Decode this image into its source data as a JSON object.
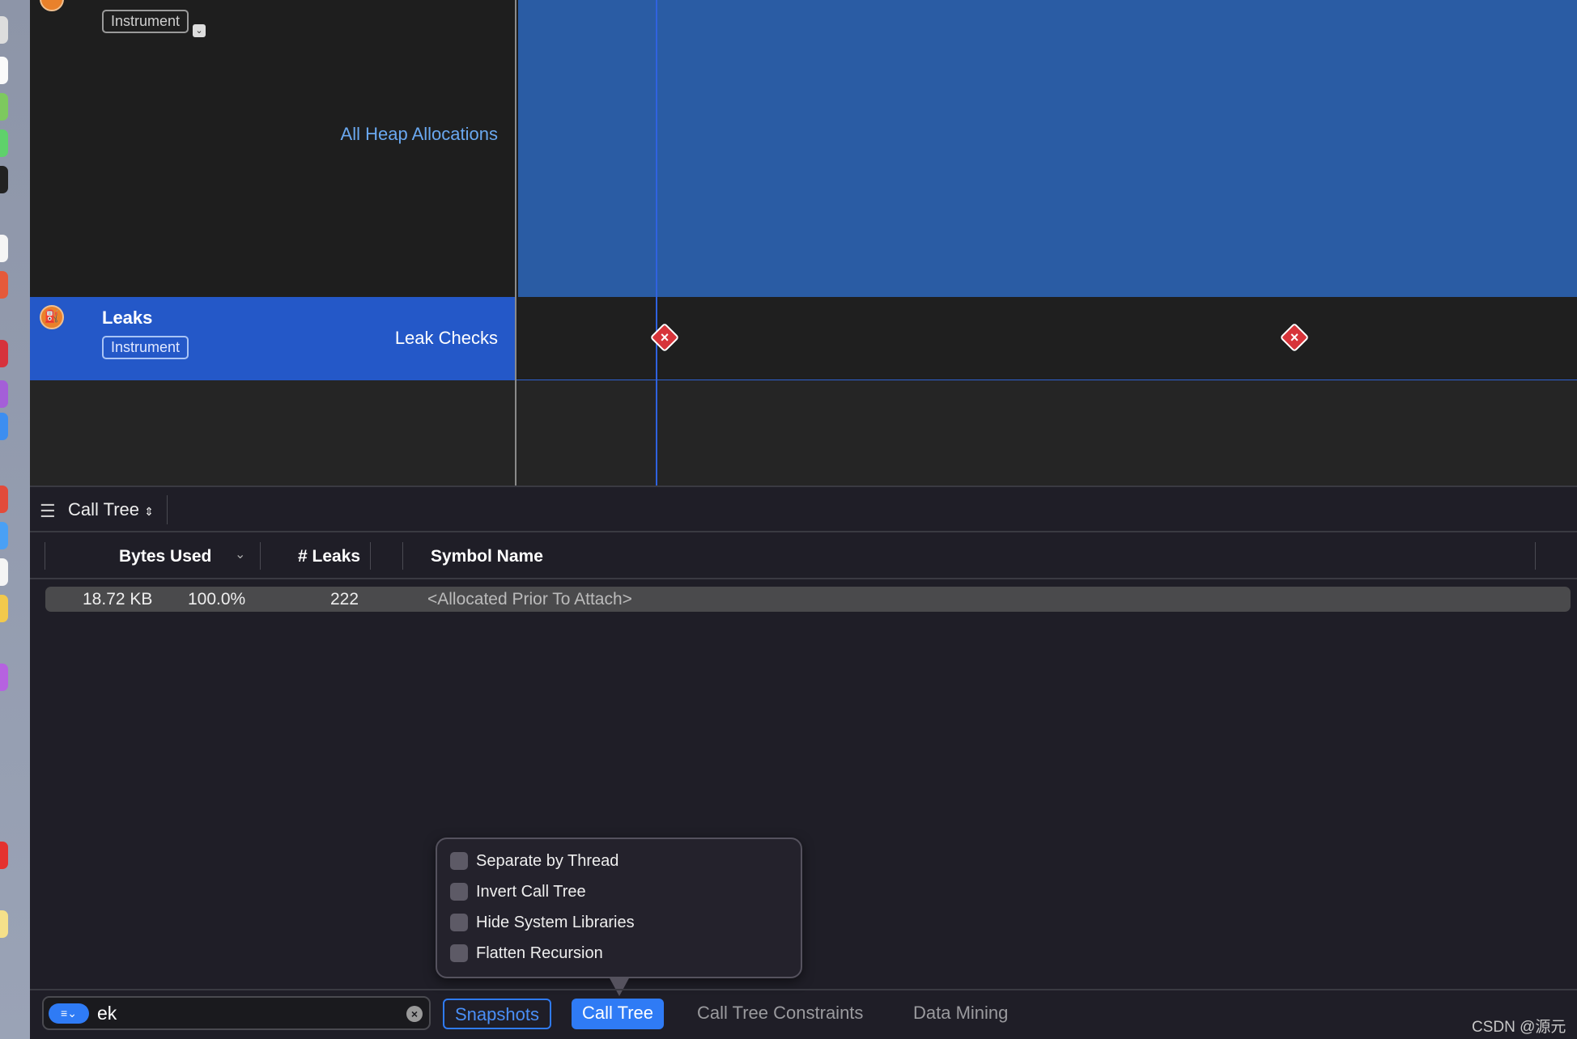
{
  "tracks": [
    {
      "type_tag": "Instrument",
      "detail": "All Heap Allocations"
    },
    {
      "name": "Leaks",
      "type_tag": "Instrument",
      "detail": "Leak Checks"
    }
  ],
  "colors": {
    "accent": "#2f7bf5",
    "selected_track": "#2458c8",
    "allocations_fill": "#2a5ca4",
    "leak_marker": "#d7343a",
    "link_text": "#6aa8f0"
  },
  "detail_view": {
    "selector_label": "Call Tree"
  },
  "table": {
    "columns": [
      "Bytes Used",
      "# Leaks",
      "Symbol Name"
    ],
    "rows": [
      {
        "bytes": "18.72 KB",
        "percent": "100.0%",
        "leaks": "222",
        "symbol": "<Allocated Prior To Attach>"
      }
    ]
  },
  "popover": {
    "options": [
      {
        "label": "Separate by Thread",
        "checked": false
      },
      {
        "label": "Invert Call Tree",
        "checked": false
      },
      {
        "label": "Hide System Libraries",
        "checked": false
      },
      {
        "label": "Flatten Recursion",
        "checked": false
      }
    ]
  },
  "bottom_bar": {
    "filter_value": "ek",
    "tabs": [
      "Snapshots",
      "Call Tree",
      "Call Tree Constraints",
      "Data Mining"
    ],
    "active_tab": "Call Tree"
  },
  "watermark": "CSDN @源元"
}
